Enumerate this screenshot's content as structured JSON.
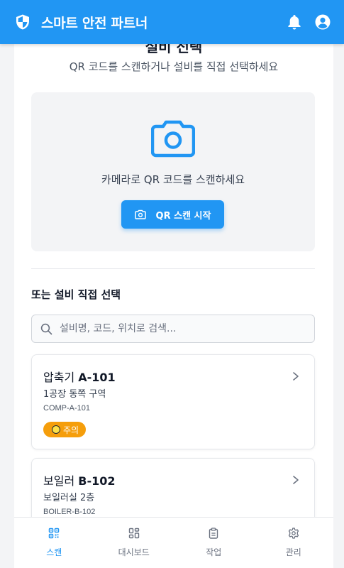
{
  "app": {
    "title": "스마트 안전 파트너"
  },
  "page": {
    "heading": "설비 선택",
    "subtitle": "QR 코드를 스캔하거나 설비를 직접 선택하세요"
  },
  "scanner": {
    "prompt": "카메라로 QR 코드를 스캔하세요",
    "button_label": "QR 스캔 시작"
  },
  "manual": {
    "label": "또는 설비 직접 선택",
    "search_placeholder": "설비명, 코드, 위치로 검색..."
  },
  "equipment": [
    {
      "name": "압축기",
      "id": "A-101",
      "location": "1공장 동쪽 구역",
      "code": "COMP-A-101",
      "status": "주의"
    },
    {
      "name": "보일러",
      "id": "B-102",
      "location": "보일러실 2층",
      "code": "BOILER-B-102",
      "status": ""
    }
  ],
  "nav": [
    {
      "label": "스캔",
      "icon": "qr-icon",
      "active": true
    },
    {
      "label": "대시보드",
      "icon": "dashboard-icon",
      "active": false
    },
    {
      "label": "작업",
      "icon": "clipboard-icon",
      "active": false
    },
    {
      "label": "관리",
      "icon": "gear-icon",
      "active": false
    }
  ],
  "colors": {
    "primary": "#2196f3",
    "warning": "#f59e0b"
  }
}
